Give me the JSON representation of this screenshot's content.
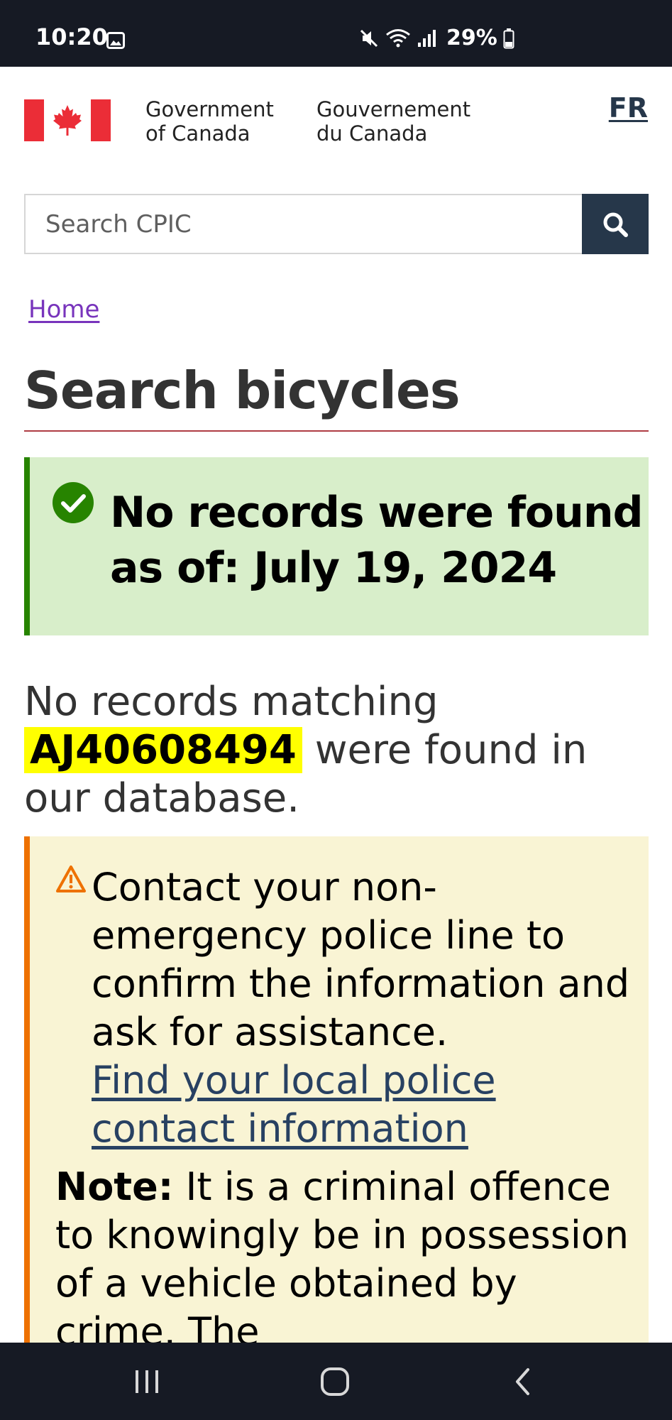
{
  "status_bar": {
    "time": "10:20",
    "battery": "29%",
    "icons": [
      "gallery-icon",
      "mute-icon",
      "wifi-icon",
      "signal-icon",
      "battery-icon"
    ]
  },
  "header": {
    "wordmark_en_line1": "Government",
    "wordmark_en_line2": "of Canada",
    "wordmark_fr_line1": "Gouvernement",
    "wordmark_fr_line2": "du Canada",
    "language_link": "FR"
  },
  "search": {
    "placeholder": "Search CPIC",
    "value": ""
  },
  "breadcrumb": {
    "home": "Home"
  },
  "page": {
    "title": "Search bicycles"
  },
  "success_alert": {
    "heading": "No records were found as of: July 19, 2024"
  },
  "result": {
    "prefix": "No records matching",
    "serial": "AJ40608494",
    "suffix": "were found in our database."
  },
  "warning_alert": {
    "text": "Contact your non-emergency police line to confirm the information and ask for assistance.",
    "link_label": "Find your local police contact information",
    "note_label": "Note:",
    "note_text": "It is a criminal offence to knowingly be in possession of a vehicle obtained by crime. The"
  },
  "colors": {
    "gov_navy": "#26374a",
    "success_bg": "#d8eeca",
    "success_border": "#278400",
    "warning_bg": "#f9f4d4",
    "warning_border": "#ee7100",
    "highlight": "#ffff00",
    "visited_link": "#7834bc"
  }
}
